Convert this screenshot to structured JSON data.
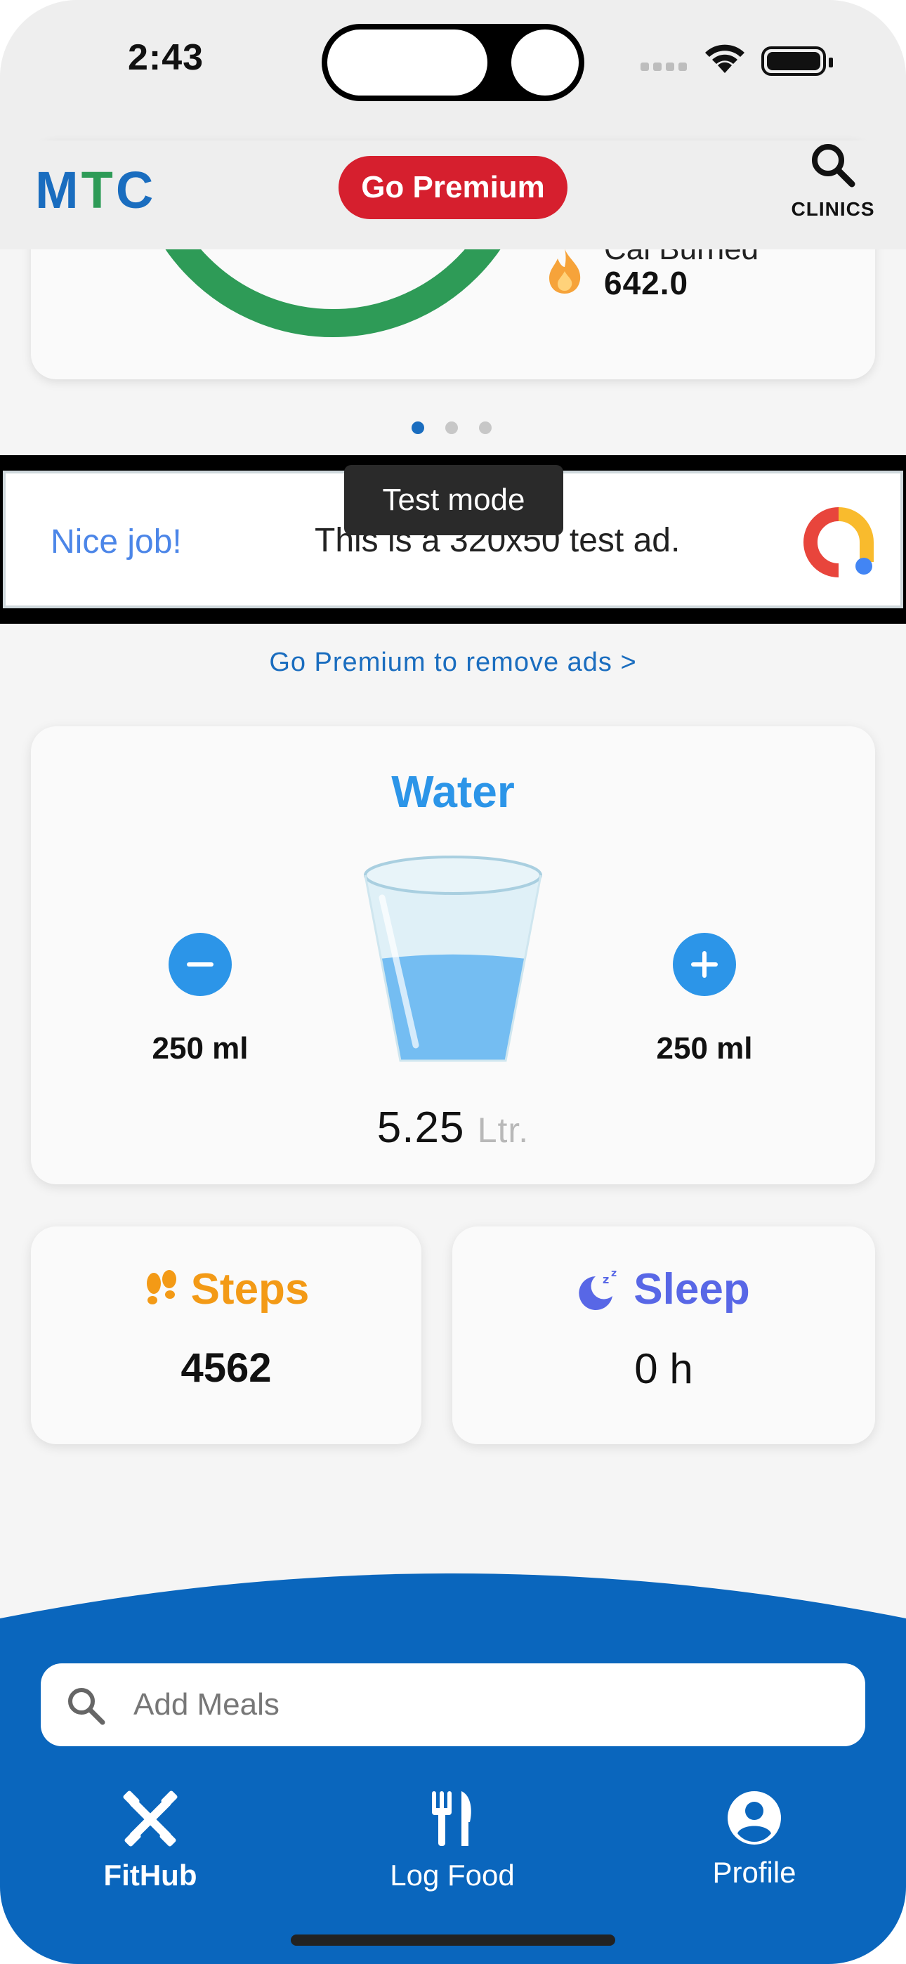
{
  "status_bar": {
    "time": "2:43"
  },
  "app_bar": {
    "logo": {
      "m": "M",
      "t": "T",
      "c": "C"
    },
    "premium_label": "Go Premium",
    "clinics_label": "CLINICS"
  },
  "calorie_card": {
    "label": "Cal Burned",
    "value": "642.0"
  },
  "ad": {
    "tooltip": "Test mode",
    "headline": "Nice job!",
    "text": "This is a 320x50 test ad.",
    "remove_ads_link": "Go Premium to remove ads >"
  },
  "water": {
    "title": "Water",
    "decrement_label": "250 ml",
    "increment_label": "250 ml",
    "amount": "5.25",
    "unit": "Ltr.",
    "fill_fraction": 0.55
  },
  "steps": {
    "title": "Steps",
    "value": "4562"
  },
  "sleep": {
    "title": "Sleep",
    "value": "0 h"
  },
  "search": {
    "placeholder": "Add Meals"
  },
  "nav": {
    "fithub": "FitHub",
    "log_food": "Log Food",
    "profile": "Profile"
  },
  "colors": {
    "brand_blue": "#1a6dbf",
    "brand_green": "#2e9b57",
    "premium_red": "#d61f2e",
    "water_blue": "#2c95e8",
    "steps_orange": "#f39a16",
    "sleep_indigo": "#5867e6",
    "nav_blue": "#0a66bd"
  },
  "icons": {
    "clinics": "search-icon",
    "calorie": "flame-icon",
    "water_decrement": "minus-icon",
    "water_increment": "plus-icon",
    "steps": "footprints-icon",
    "sleep": "moon-zzz-icon",
    "search": "search-icon",
    "fithub": "crossed-tools-icon",
    "log_food": "fork-knife-icon",
    "profile": "account-circle-icon"
  }
}
